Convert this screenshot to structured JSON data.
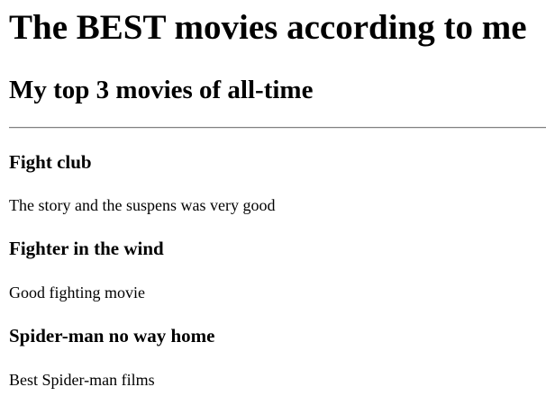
{
  "page": {
    "heading": "The BEST movies according to me",
    "subheading": "My top 3 movies of all-time"
  },
  "movies": [
    {
      "title": "Fight club",
      "description": "The story and the suspens was very good"
    },
    {
      "title": "Fighter in the wind",
      "description": "Good fighting movie"
    },
    {
      "title": "Spider-man no way home",
      "description": "Best Spider-man films"
    }
  ]
}
